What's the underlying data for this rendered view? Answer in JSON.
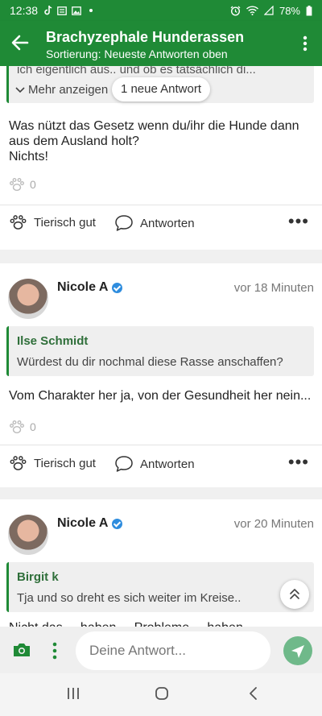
{
  "status_bar": {
    "time": "12:38",
    "battery": "78%"
  },
  "app_bar": {
    "title": "Brachyzephale Hunderassen",
    "subtitle": "Sortierung: Neueste Antworten oben"
  },
  "new_answers_pill": "1 neue Antwort",
  "posts": [
    {
      "quote_partial_text": "ich eigentlich aus.. und ob es tatsächlich di...",
      "show_more": "Mehr anzeigen",
      "body_lines": [
        "Was nützt das Gesetz wenn du/ihr die Hunde dann",
        "aus dem Ausland holt?",
        "Nichts!"
      ],
      "paw_count": "0",
      "like_label": "Tierisch gut",
      "reply_label": "Antworten"
    },
    {
      "author": "Nicole A",
      "time_ago": "vor 18 Minuten",
      "quote_author": "Ilse Schmidt",
      "quote_text": "Würdest du dir nochmal diese Rasse anschaffen?",
      "body_lines": [
        "Vom Charakter her ja, von der Gesundheit her nein..."
      ],
      "paw_count": "0",
      "like_label": "Tierisch gut",
      "reply_label": "Antworten"
    },
    {
      "author": "Nicole A",
      "time_ago": "vor 20 Minuten",
      "quote_author": "Birgit k",
      "quote_text": "Tja und so dreht es sich weiter im Kreise..",
      "body_partial": "Nicht das ... haben ... Probleme ... haben ..."
    }
  ],
  "composer": {
    "placeholder": "Deine Antwort..."
  },
  "colors": {
    "brand_green": "#1f8a36",
    "verified_blue": "#2f8dde",
    "send_green": "#6fb98a"
  }
}
